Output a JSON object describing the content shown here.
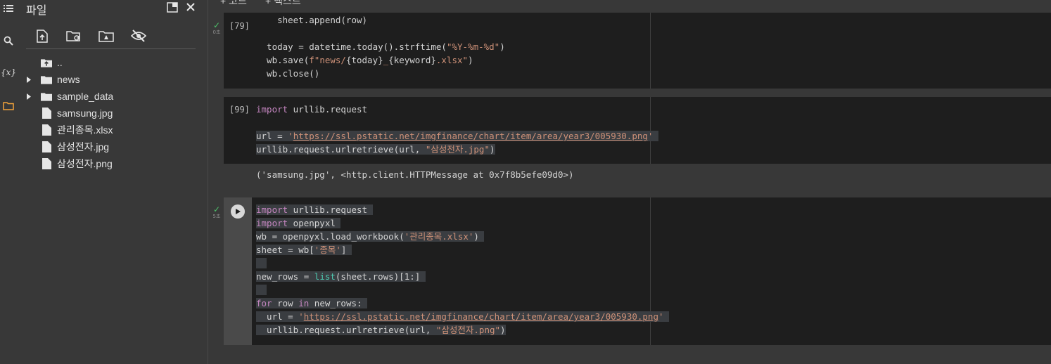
{
  "panel": {
    "title": "파일",
    "tree": [
      {
        "label": "..",
        "type": "up",
        "expandable": false
      },
      {
        "label": "news",
        "type": "folder",
        "expandable": true
      },
      {
        "label": "sample_data",
        "type": "folder",
        "expandable": true
      },
      {
        "label": "samsung.jpg",
        "type": "file",
        "expandable": false
      },
      {
        "label": "관리종목.xlsx",
        "type": "file",
        "expandable": false
      },
      {
        "label": "삼성전자.jpg",
        "type": "file",
        "expandable": false
      },
      {
        "label": "삼성전자.png",
        "type": "file",
        "expandable": false
      }
    ]
  },
  "rail": {
    "variables_label": "{x}"
  },
  "topbar": {
    "add_code": "+ 코드",
    "add_text": "+ 텍스트"
  },
  "cells": [
    {
      "exec_count": "[79]",
      "status_check": "✓",
      "status_time": "0초"
    },
    {
      "exec_count": "[99]",
      "output": "('samsung.jpg', <http.client.HTTPMessage at 0x7f8b5efe09d0>)"
    },
    {
      "status_check": "✓",
      "status_time": "5초"
    }
  ],
  "colors": {
    "accent_orange": "#f2a33a",
    "check_green": "#4ec16a",
    "code_bg": "#1e1e1e",
    "panel_bg": "#383838"
  }
}
